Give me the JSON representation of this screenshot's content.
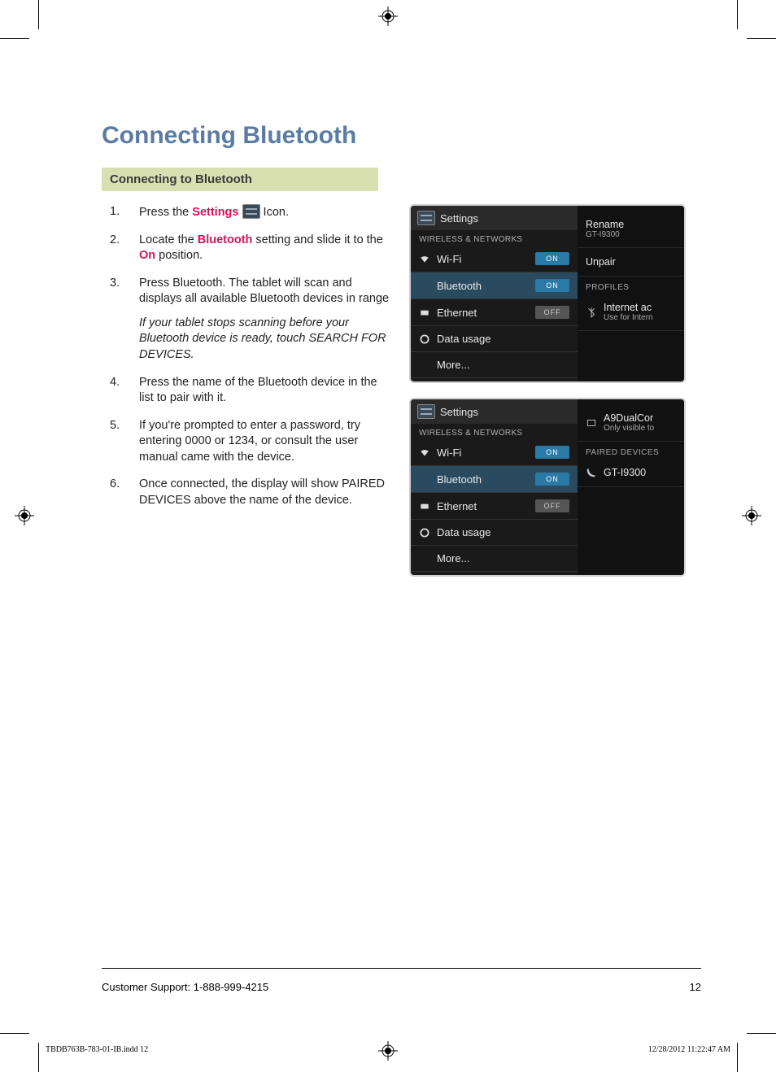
{
  "title": "Connecting Bluetooth",
  "subheader": "Connecting to Bluetooth",
  "steps": {
    "s1a": "Press the ",
    "s1_settings": "Settings",
    "s1b": " Icon.",
    "s2a": "Locate the ",
    "s2_bt": "Bluetooth",
    "s2b": " setting and slide it to the ",
    "s2_on": "On",
    "s2c": " position.",
    "s3": "Press Bluetooth. The tablet will scan and displays all available Bluetooth devices in range",
    "s3_note": "If your tablet stops scanning before your Bluetooth device is ready, touch SEARCH FOR DEVICES.",
    "s4": "Press the name of the Bluetooth device in the list to pair with it.",
    "s5": "If you're prompted to enter a password, try entering 0000 or 1234, or consult the user manual came with the device.",
    "s6": "Once connected, the display will show PAIRED DEVICES above the name of the device."
  },
  "shot1": {
    "title": "Settings",
    "section": "WIRELESS & NETWORKS",
    "rows": {
      "wifi": "Wi-Fi",
      "bt": "Bluetooth",
      "eth": "Ethernet",
      "data": "Data usage",
      "more": "More..."
    },
    "toggles": {
      "on": "ON",
      "off": "OFF"
    },
    "right": {
      "rename": "Rename",
      "rename_sub": "GT-I9300",
      "unpair": "Unpair",
      "profiles": "PROFILES",
      "ia": "Internet ac",
      "ia_sub": "Use for Intern"
    }
  },
  "shot2": {
    "title": "Settings",
    "section": "WIRELESS & NETWORKS",
    "rows": {
      "wifi": "Wi-Fi",
      "bt": "Bluetooth",
      "eth": "Ethernet",
      "data": "Data usage",
      "more": "More..."
    },
    "toggles": {
      "on": "ON",
      "off": "OFF"
    },
    "right": {
      "dev": "A9DualCor",
      "dev_sub": "Only visible to",
      "paired": "PAIRED DEVICES",
      "gt": "GT-I9300"
    }
  },
  "footer": {
    "support": "Customer Support: 1-888-999-4215",
    "page": "12"
  },
  "imprint": {
    "file": "TBDB763B-783-01-IB.indd   12",
    "ts": "12/28/2012   11:22:47 AM"
  }
}
